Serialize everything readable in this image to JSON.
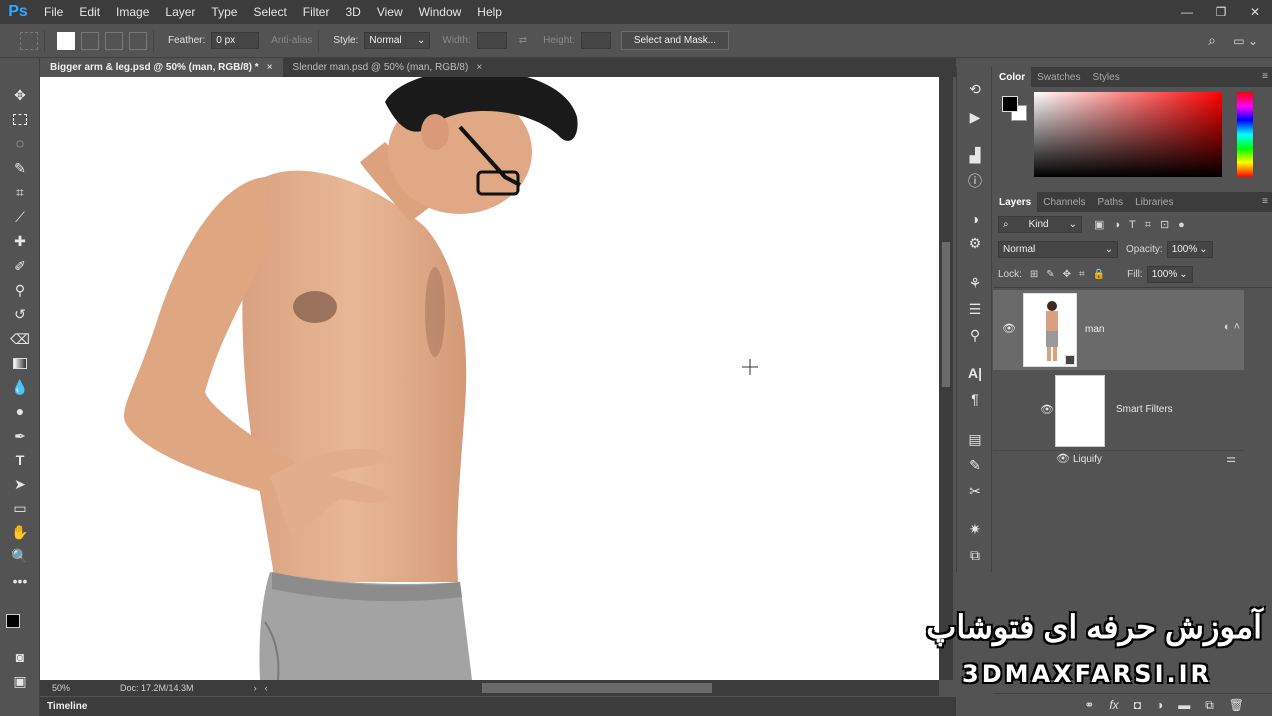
{
  "app": {
    "logo": "Ps"
  },
  "menu": [
    "File",
    "Edit",
    "Image",
    "Layer",
    "Type",
    "Select",
    "Filter",
    "3D",
    "View",
    "Window",
    "Help"
  ],
  "options": {
    "feather_label": "Feather:",
    "feather_value": "0 px",
    "antialias_label": "Anti-alias",
    "style_label": "Style:",
    "style_value": "Normal",
    "width_label": "Width:",
    "height_label": "Height:",
    "select_mask_label": "Select and Mask..."
  },
  "tabs": [
    {
      "label": "Bigger arm & leg.psd @ 50% (man, RGB/8) *",
      "close": "×"
    },
    {
      "label": "Slender man.psd @ 50% (man, RGB/8)",
      "close": "×"
    }
  ],
  "status": {
    "zoom": "50%",
    "doc": "Doc: 17.2M/14.3M"
  },
  "timeline": {
    "label": "Timeline"
  },
  "color_panel": {
    "tabs": [
      "Color",
      "Swatches",
      "Styles"
    ],
    "foreground": "#000000",
    "background": "#ffffff",
    "hue": "#ff0000"
  },
  "layers_panel": {
    "tabs": [
      "Layers",
      "Channels",
      "Paths",
      "Libraries"
    ],
    "kind_label": "Kind",
    "blend_mode": "Normal",
    "opacity_label": "Opacity:",
    "opacity_value": "100%",
    "lock_label": "Lock:",
    "fill_label": "Fill:",
    "fill_value": "100%",
    "layers": [
      {
        "name": "man"
      },
      {
        "name": "Smart Filters"
      },
      {
        "name": "Liquify"
      }
    ]
  },
  "watermark": {
    "line1": "آموزش حرفه ای فتوشاپ",
    "line2": "3DMAXFARSI.IR"
  }
}
